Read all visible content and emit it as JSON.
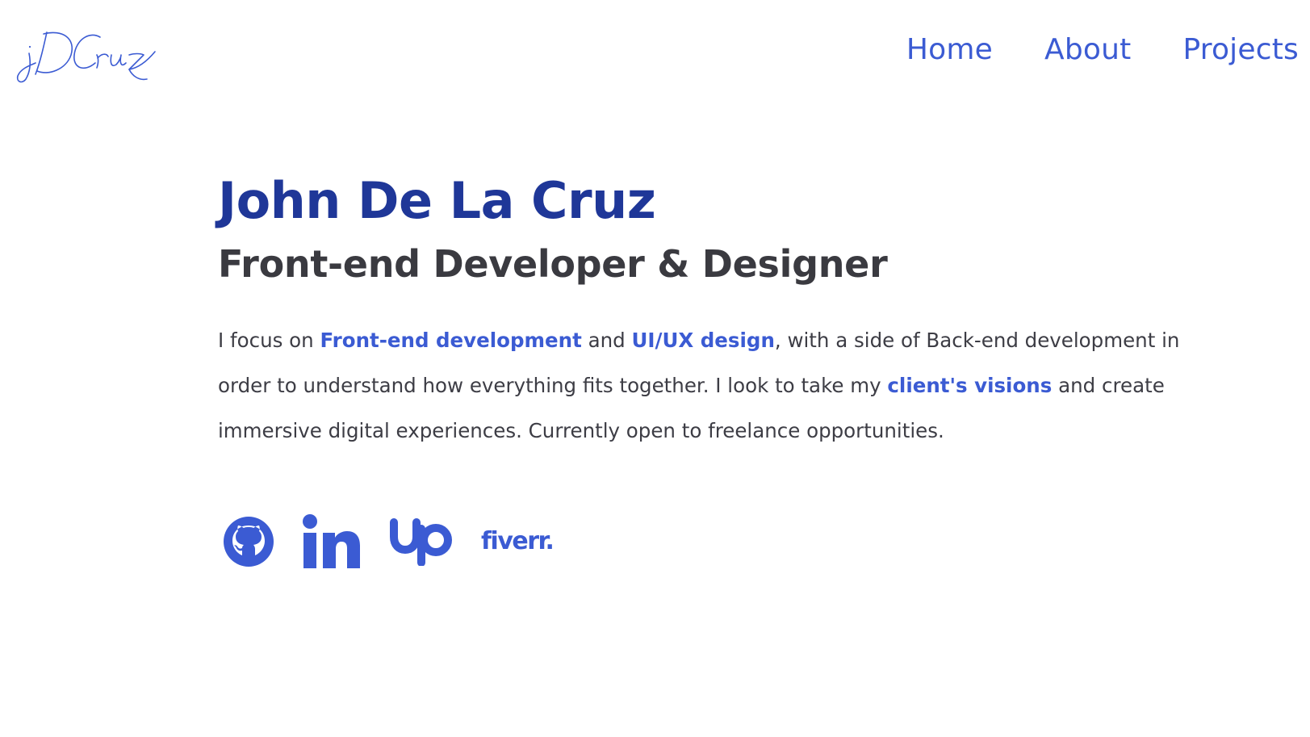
{
  "brand": {
    "logo_text": "jDCruz",
    "logo_icon": "signature-logo"
  },
  "nav": {
    "items": [
      {
        "label": "Home"
      },
      {
        "label": "About"
      },
      {
        "label": "Projects"
      }
    ]
  },
  "hero": {
    "name": "John De La Cruz",
    "role": "Front-end Developer & Designer",
    "bio": {
      "part1": "I focus on ",
      "highlight1": "Front-end development",
      "part2": " and ",
      "highlight2": "UI/UX design",
      "part3": ", with a side of Back-end development in order to understand how everything fits together. I look to take my ",
      "highlight3": "client's visions",
      "part4": " and create immersive digital experiences. Currently open to freelance opportunities."
    }
  },
  "socials": [
    {
      "name": "github",
      "icon": "github-icon"
    },
    {
      "name": "linkedin",
      "icon": "linkedin-icon"
    },
    {
      "name": "upwork",
      "icon": "upwork-icon"
    },
    {
      "name": "fiverr",
      "icon": "fiverr-icon",
      "text": "fiverr."
    }
  ],
  "colors": {
    "accent": "#3b5bd3",
    "name": "#1f3798",
    "heading": "#3a3a40",
    "body": "#3d3d45",
    "background": "#ffffff"
  }
}
